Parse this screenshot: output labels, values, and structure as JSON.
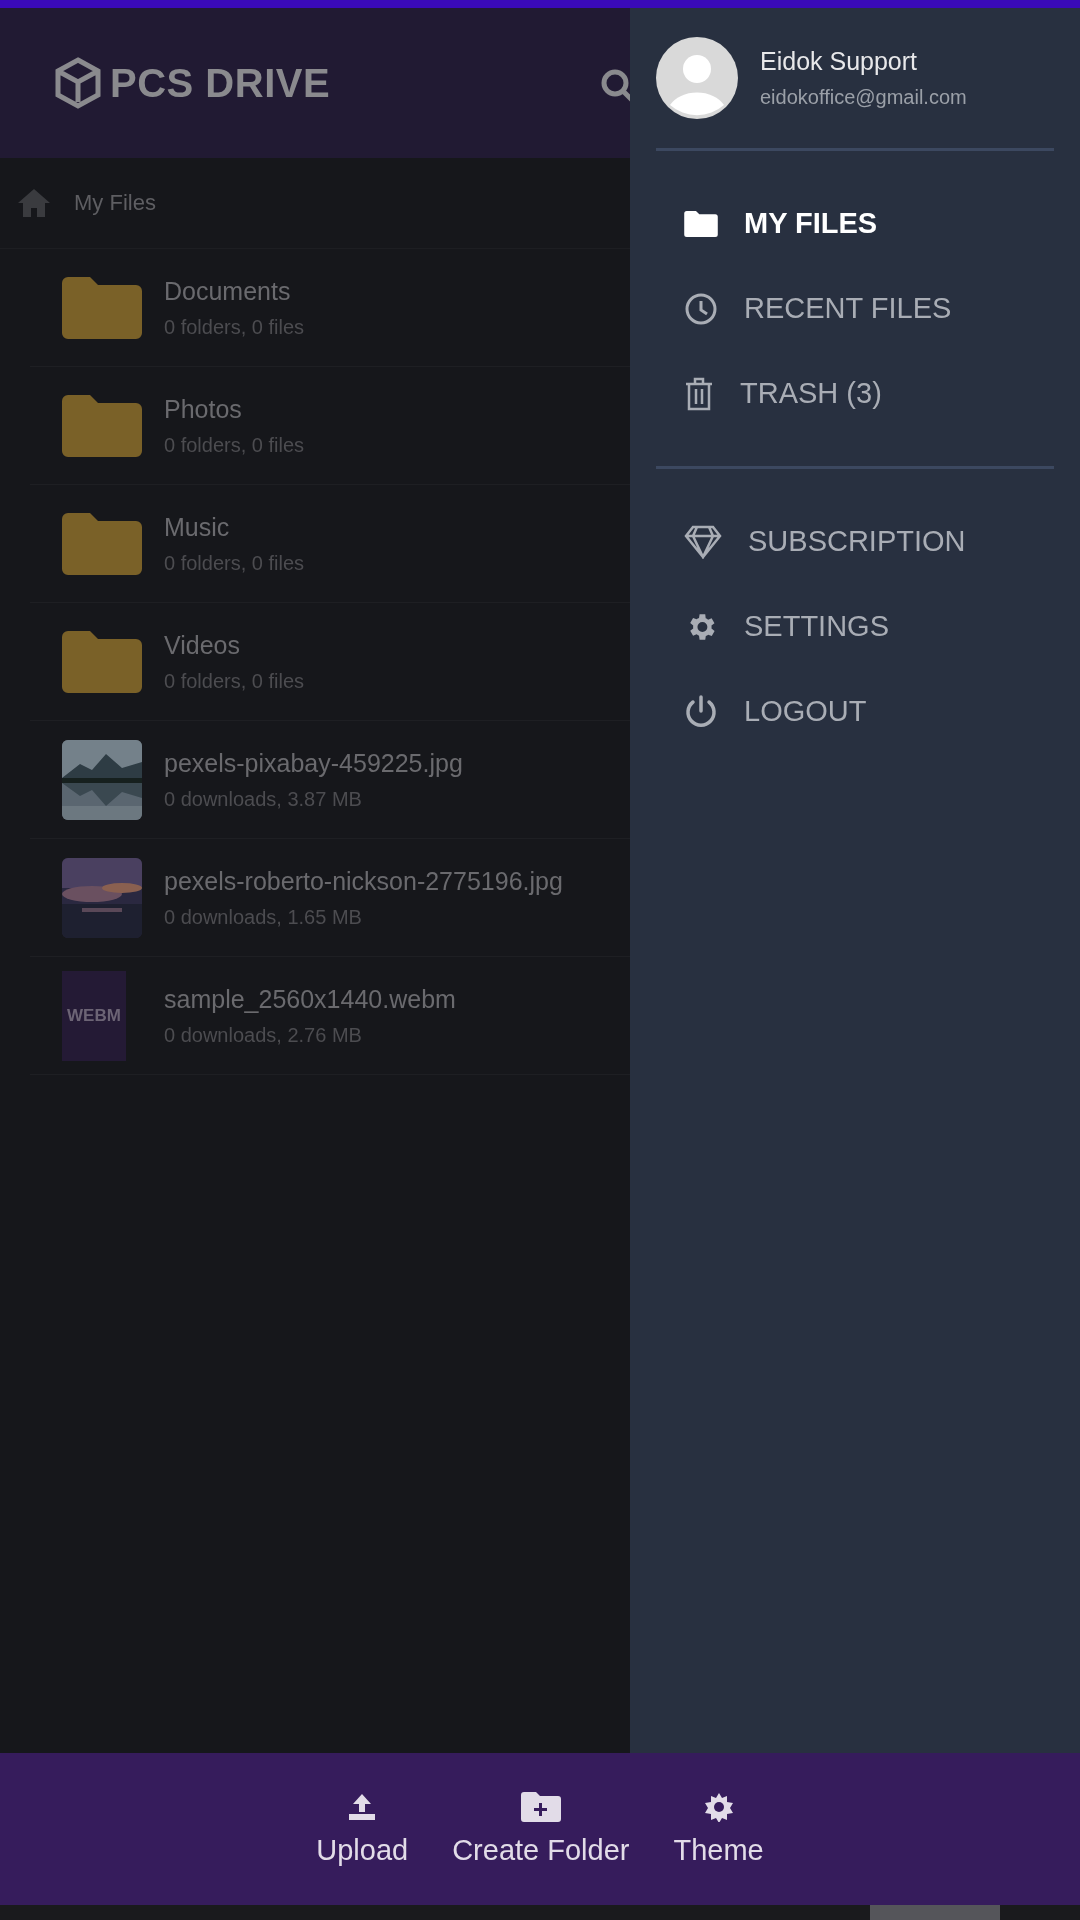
{
  "header": {
    "logo": "PCS DRIVE"
  },
  "breadcrumb": {
    "label": "My Files"
  },
  "files": [
    {
      "kind": "folder",
      "name": "Documents",
      "meta": "0 folders, 0 files"
    },
    {
      "kind": "folder",
      "name": "Photos",
      "meta": "0 folders, 0 files"
    },
    {
      "kind": "folder",
      "name": "Music",
      "meta": "0 folders, 0 files"
    },
    {
      "kind": "folder",
      "name": "Videos",
      "meta": "0 folders, 0 files"
    },
    {
      "name": "pexels-pixabay-459225.jpg",
      "meta": "0 downloads, 3.87 MB"
    },
    {
      "name": "pexels-roberto-nickson-2775196.jpg",
      "meta": "0 downloads, 1.65 MB"
    },
    {
      "kind": "video",
      "name": "sample_2560x1440.webm",
      "meta": "0 downloads, 2.76 MB",
      "badge": "WEBM"
    }
  ],
  "drawer": {
    "user": {
      "name": "Eidok Support",
      "email": "eidokoffice@gmail.com"
    },
    "groups": [
      [
        {
          "kind": "folder",
          "label": "MY FILES",
          "selected": true
        },
        {
          "kind": "clock",
          "label": "RECENT FILES",
          "selected": false
        },
        {
          "kind": "trash",
          "label": "TRASH (3)",
          "selected": false
        }
      ],
      [
        {
          "kind": "diamond",
          "label": "SUBSCRIPTION",
          "selected": false
        },
        {
          "kind": "gear",
          "label": "SETTINGS",
          "selected": false
        },
        {
          "kind": "power",
          "label": "LOGOUT",
          "selected": false
        }
      ]
    ]
  },
  "bottom_bar": [
    {
      "kind": "upload",
      "label": "Upload"
    },
    {
      "kind": "folder-plus",
      "label": "Create Folder"
    },
    {
      "kind": "sun",
      "label": "Theme"
    }
  ]
}
